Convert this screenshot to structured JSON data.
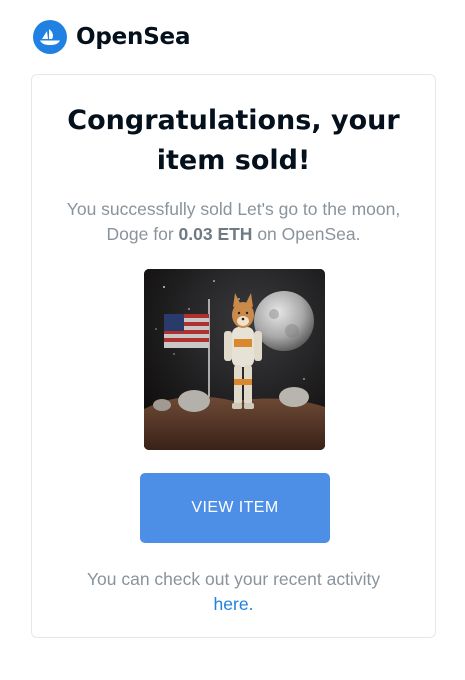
{
  "header": {
    "brand": "OpenSea",
    "logo_icon": "opensea-logo-icon"
  },
  "card": {
    "title": "Congratulations, your item sold!",
    "message": {
      "prefix": "You successfully sold Let's go to the moon, Doge for ",
      "price": "0.03 ETH",
      "suffix": " on OpenSea."
    },
    "nft_image": "dog-astronaut-on-moon-image",
    "view_button_label": "VIEW ITEM",
    "footer": {
      "text": "You can check out your recent activity ",
      "link_label": "here."
    }
  },
  "colors": {
    "brand_blue": "#2081e2",
    "button_blue": "#4d8fe6",
    "muted_text": "#8a939b",
    "title_text": "#04111d"
  }
}
